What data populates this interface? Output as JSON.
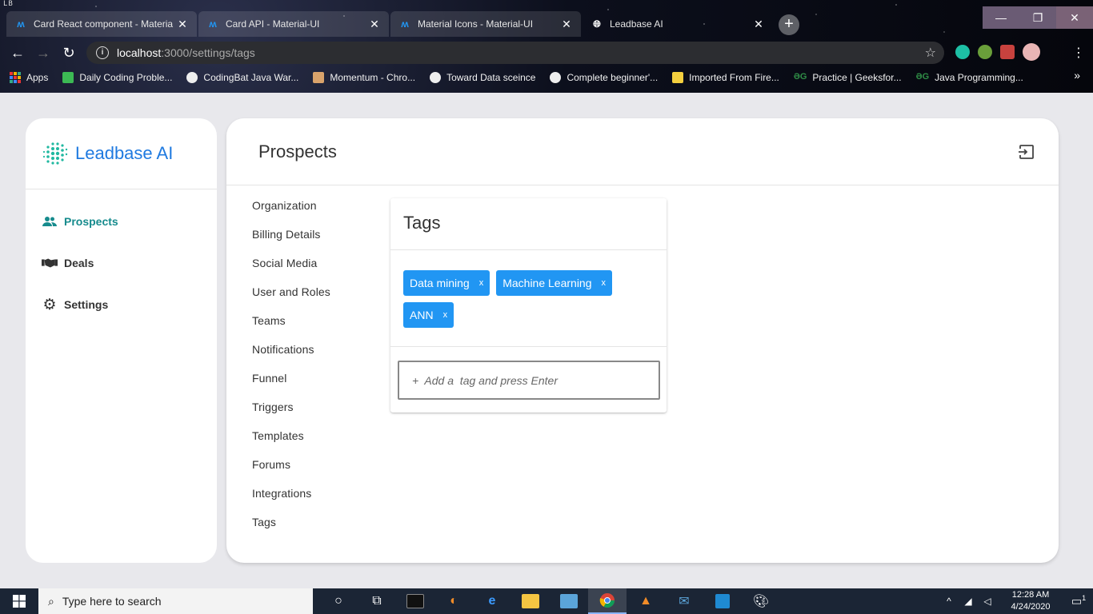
{
  "browser": {
    "os_label": "LB",
    "tabs": [
      {
        "title": "Card React component - Materia",
        "icon": "material-ui-icon"
      },
      {
        "title": "Card API - Material-UI",
        "icon": "material-ui-icon"
      },
      {
        "title": "Material Icons - Material-UI",
        "icon": "material-ui-icon"
      },
      {
        "title": "Leadbase AI",
        "icon": "globe-icon"
      }
    ],
    "url_host": "localhost",
    "url_path": ":3000/settings/tags",
    "bookmarks": [
      {
        "label": "Apps"
      },
      {
        "label": "Daily Coding Proble..."
      },
      {
        "label": "CodingBat Java War..."
      },
      {
        "label": "Momentum - Chro..."
      },
      {
        "label": "Toward Data sceince"
      },
      {
        "label": "Complete beginner'..."
      },
      {
        "label": "Imported From Fire..."
      },
      {
        "label": "Practice | Geeksfor..."
      },
      {
        "label": "Java Programming..."
      }
    ]
  },
  "app": {
    "brand": "Leadbase AI",
    "nav": [
      {
        "label": "Prospects",
        "icon": "people-icon",
        "active": true
      },
      {
        "label": "Deals",
        "icon": "handshake-icon",
        "active": false
      },
      {
        "label": "Settings",
        "icon": "gear-icon",
        "active": false
      }
    ],
    "page_title": "Prospects",
    "settings_menu": [
      "Organization",
      "Billing Details",
      "Social Media",
      "User and Roles",
      "Teams",
      "Notifications",
      "Funnel",
      "Triggers",
      "Templates",
      "Forums",
      "Integrations",
      "Tags"
    ],
    "tags_card": {
      "title": "Tags",
      "tags": [
        "Data mining",
        "Machine Learning",
        "ANN"
      ],
      "remove_label": "x",
      "input_placeholder": "+  Add a  tag and press Enter",
      "input_value": ""
    }
  },
  "taskbar": {
    "search_placeholder": "Type here to search",
    "time": "12:28 AM",
    "date": "4/24/2020",
    "notification_count": "1"
  },
  "colors": {
    "brand_blue": "#1f7ae0",
    "active_teal": "#168b8d",
    "chip_blue": "#2196f3"
  }
}
